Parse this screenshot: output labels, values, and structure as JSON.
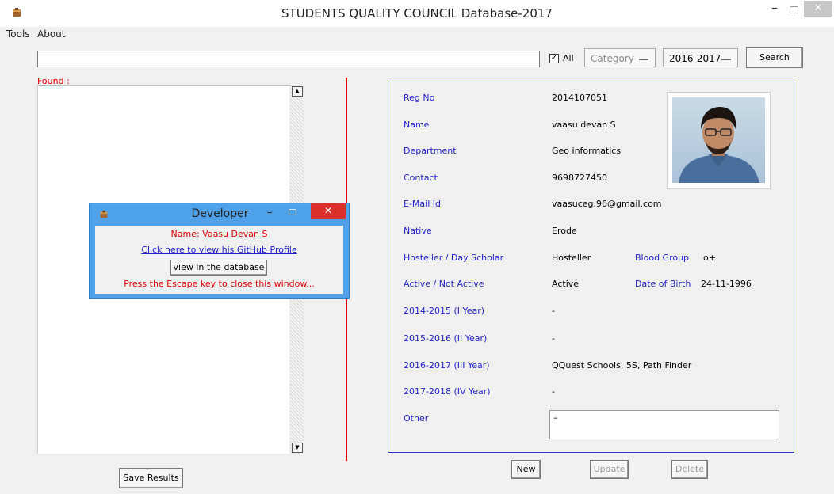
{
  "window": {
    "title": "STUDENTS QUALITY COUNCIL Database-2017",
    "minimize": "–",
    "close": "✕"
  },
  "menu": [
    "Tools",
    "About"
  ],
  "search": {
    "query": "",
    "all_checked": true,
    "all_label": "All",
    "category": "Category",
    "year": "2016-2017",
    "button": "Search"
  },
  "results": {
    "found_label": "Found :",
    "scroll_up": "▲",
    "scroll_down": "▼",
    "save_button": "Save Results"
  },
  "record": {
    "photo_icon": "student-photo",
    "reg_no": {
      "label": "Reg No",
      "value": "2014107051"
    },
    "name": {
      "label": "Name",
      "value": "vaasu devan S"
    },
    "department": {
      "label": "Department",
      "value": "Geo informatics"
    },
    "contact": {
      "label": "Contact",
      "value": "9698727450"
    },
    "email": {
      "label": "E-Mail Id",
      "value": "vaasuceg.96@gmail.com"
    },
    "native": {
      "label": "Native",
      "value": "Erode"
    },
    "hosteller": {
      "label": "Hosteller / Day Scholar",
      "value": "Hosteller"
    },
    "blood_group": {
      "label": "Blood Group",
      "value": "o+"
    },
    "active": {
      "label": "Active / Not Active",
      "value": "Active"
    },
    "dob": {
      "label": "Date of Birth",
      "value": "24-11-1996"
    },
    "year1": {
      "label": "2014-2015 (I Year)",
      "value": "-"
    },
    "year2": {
      "label": "2015-2016 (II Year)",
      "value": "-"
    },
    "year3": {
      "label": "2016-2017 (III Year)",
      "value": "QQuest Schools, 5S, Path Finder"
    },
    "year4": {
      "label": "2017-2018 (IV Year)",
      "value": "-"
    },
    "other": {
      "label": "Other",
      "value": "–"
    }
  },
  "actions": {
    "new": "New",
    "update": "Update",
    "delete": "Delete"
  },
  "developer": {
    "title": "Developer",
    "minimize": "–",
    "close": "✕",
    "name_line": "Name:  Vaasu Devan S",
    "github_link": "Click here to view his GitHub Profile",
    "view_button": "view in the database",
    "escape_hint": "Press the Escape key to close this window..."
  },
  "colors": {
    "label_blue": "#2222cc",
    "accent_red": "#e00000",
    "popup_blue": "#4fa2ea",
    "close_red": "#d9302c"
  }
}
